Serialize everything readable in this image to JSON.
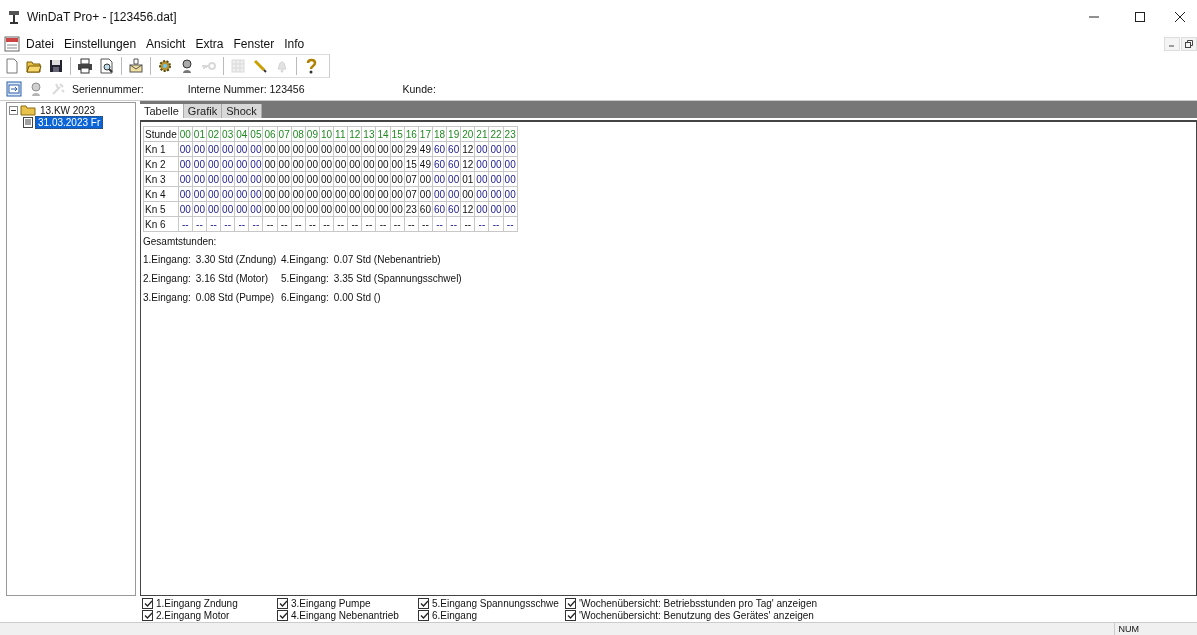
{
  "window": {
    "title": "WinDaT Pro+ - [123456.dat]"
  },
  "menu": [
    "Datei",
    "Einstellungen",
    "Ansicht",
    "Extra",
    "Fenster",
    "Info"
  ],
  "toolbar": [
    {
      "kind": "new",
      "disabled": false
    },
    {
      "kind": "open",
      "disabled": false
    },
    {
      "kind": "save",
      "disabled": false
    },
    {
      "kind": "sep"
    },
    {
      "kind": "print",
      "disabled": false
    },
    {
      "kind": "preview",
      "disabled": false
    },
    {
      "kind": "sep"
    },
    {
      "kind": "tray",
      "disabled": false
    },
    {
      "kind": "sep"
    },
    {
      "kind": "gear",
      "disabled": false
    },
    {
      "kind": "head",
      "disabled": false
    },
    {
      "kind": "key",
      "disabled": true
    },
    {
      "kind": "sep"
    },
    {
      "kind": "grid",
      "disabled": true
    },
    {
      "kind": "pen",
      "disabled": false
    },
    {
      "kind": "bell",
      "disabled": true
    },
    {
      "kind": "sep"
    },
    {
      "kind": "help",
      "disabled": false
    }
  ],
  "infobar": {
    "tools": [
      {
        "kind": "view",
        "disabled": false
      },
      {
        "kind": "head",
        "disabled": true
      },
      {
        "kind": "wrench",
        "disabled": true
      }
    ],
    "serial_label": "Seriennummer:",
    "internal_number": "Interne Nummer: 123456",
    "customer_label": "Kunde:"
  },
  "tree": [
    {
      "label": "13.KW 2023",
      "expanded": true,
      "children": [
        {
          "label": "31.03.2023 Fr",
          "selected": true
        }
      ]
    }
  ],
  "tabs": [
    {
      "label": "Tabelle",
      "selected": true
    },
    {
      "label": "Grafik",
      "selected": false
    },
    {
      "label": "Shock",
      "selected": false
    }
  ],
  "table": {
    "header": "Stunde",
    "hours": [
      {
        "label": "00",
        "kind": "blue"
      },
      {
        "label": "01",
        "kind": "blue"
      },
      {
        "label": "02",
        "kind": "blue"
      },
      {
        "label": "03",
        "kind": "blue"
      },
      {
        "label": "04",
        "kind": "blue"
      },
      {
        "label": "05",
        "kind": "blue"
      },
      {
        "label": "06",
        "kind": "black"
      },
      {
        "label": "07",
        "kind": "black"
      },
      {
        "label": "08",
        "kind": "black"
      },
      {
        "label": "09",
        "kind": "black"
      },
      {
        "label": "10",
        "kind": "black"
      },
      {
        "label": "11",
        "kind": "black"
      },
      {
        "label": "12",
        "kind": "black"
      },
      {
        "label": "13",
        "kind": "black"
      },
      {
        "label": "14",
        "kind": "black"
      },
      {
        "label": "15",
        "kind": "black"
      },
      {
        "label": "16",
        "kind": "black"
      },
      {
        "label": "17",
        "kind": "black"
      },
      {
        "label": "18",
        "kind": "blue"
      },
      {
        "label": "19",
        "kind": "blue"
      },
      {
        "label": "20",
        "kind": "black"
      },
      {
        "label": "21",
        "kind": "blue"
      },
      {
        "label": "22",
        "kind": "blue"
      },
      {
        "label": "23",
        "kind": "blue"
      }
    ],
    "rows": [
      {
        "label": "Kn 1",
        "values": [
          "00",
          "00",
          "00",
          "00",
          "00",
          "00",
          "00",
          "00",
          "00",
          "00",
          "00",
          "00",
          "00",
          "00",
          "00",
          "00",
          "29",
          "49",
          "60",
          "60",
          "12",
          "00",
          "00",
          "00"
        ]
      },
      {
        "label": "Kn 2",
        "values": [
          "00",
          "00",
          "00",
          "00",
          "00",
          "00",
          "00",
          "00",
          "00",
          "00",
          "00",
          "00",
          "00",
          "00",
          "00",
          "00",
          "15",
          "49",
          "60",
          "60",
          "12",
          "00",
          "00",
          "00"
        ]
      },
      {
        "label": "Kn 3",
        "values": [
          "00",
          "00",
          "00",
          "00",
          "00",
          "00",
          "00",
          "00",
          "00",
          "00",
          "00",
          "00",
          "00",
          "00",
          "00",
          "00",
          "07",
          "00",
          "00",
          "00",
          "01",
          "00",
          "00",
          "00"
        ]
      },
      {
        "label": "Kn 4",
        "values": [
          "00",
          "00",
          "00",
          "00",
          "00",
          "00",
          "00",
          "00",
          "00",
          "00",
          "00",
          "00",
          "00",
          "00",
          "00",
          "00",
          "07",
          "00",
          "00",
          "00",
          "00",
          "00",
          "00",
          "00"
        ]
      },
      {
        "label": "Kn 5",
        "values": [
          "00",
          "00",
          "00",
          "00",
          "00",
          "00",
          "00",
          "00",
          "00",
          "00",
          "00",
          "00",
          "00",
          "00",
          "00",
          "00",
          "23",
          "60",
          "60",
          "60",
          "12",
          "00",
          "00",
          "00"
        ]
      },
      {
        "label": "Kn 6",
        "values": [
          "--",
          "--",
          "--",
          "--",
          "--",
          "--",
          "--",
          "--",
          "--",
          "--",
          "--",
          "--",
          "--",
          "--",
          "--",
          "--",
          "--",
          "--",
          "--",
          "--",
          "--",
          "--",
          "--",
          "--"
        ]
      }
    ]
  },
  "totals": {
    "title": "Gesamtstunden:",
    "lines": [
      {
        "label": "1.Eingang:",
        "value": "3.30 Std (Zndung)"
      },
      {
        "label": "2.Eingang:",
        "value": "3.16 Std (Motor)"
      },
      {
        "label": "3.Eingang:",
        "value": "0.08 Std (Pumpe)"
      },
      {
        "label": "4.Eingang:",
        "value": "0.07 Std (Nebenantrieb)"
      },
      {
        "label": "5.Eingang:",
        "value": "3.35 Std (Spannungsschwel)"
      },
      {
        "label": "6.Eingang:",
        "value": "0.00 Std ()"
      }
    ]
  },
  "options": [
    {
      "label": "1.Eingang Zndung",
      "checked": true
    },
    {
      "label": "2.Eingang Motor",
      "checked": true
    },
    {
      "label": "3.Eingang Pumpe",
      "checked": true
    },
    {
      "label": "4.Eingang Nebenantrieb",
      "checked": true
    },
    {
      "label": "5.Eingang Spannungsschwe",
      "checked": true
    },
    {
      "label": "6.Eingang",
      "checked": true
    },
    {
      "label": "'Wochenübersicht: Betriebsstunden pro Tag' anzeigen",
      "checked": true
    },
    {
      "label": "'Wochenübersicht: Benutzung des Gerätes' anzeigen",
      "checked": true
    }
  ],
  "status_bar": {
    "indicator": "NUM"
  }
}
